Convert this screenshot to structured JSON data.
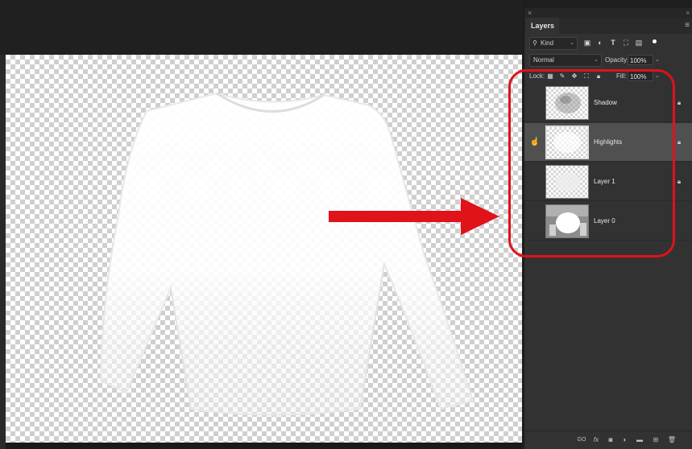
{
  "panel": {
    "tab_label": "Layers",
    "close_glyph": "×",
    "collapse_glyph": "»",
    "menu_glyph": "≡"
  },
  "filter": {
    "kind_label": "Kind",
    "icons": [
      "pixel-filter-icon",
      "adjustment-filter-icon",
      "type-filter-icon",
      "shape-filter-icon",
      "smart-object-filter-icon"
    ]
  },
  "blend": {
    "mode": "Normal",
    "opacity_label": "Opacity:",
    "opacity_value": "100%"
  },
  "lock": {
    "label": "Lock:",
    "fill_label": "Fill:",
    "fill_value": "100%"
  },
  "layers": [
    {
      "name": "Shadow",
      "visible": false,
      "selected": false,
      "locked": true
    },
    {
      "name": "Highlights",
      "visible": true,
      "selected": true,
      "locked": true
    },
    {
      "name": "Layer 1",
      "visible": false,
      "selected": false,
      "locked": true
    },
    {
      "name": "Layer 0",
      "visible": false,
      "selected": false,
      "locked": false
    }
  ],
  "footer": {
    "labels": [
      "GO",
      "fx"
    ]
  },
  "colors": {
    "annotation_red": "#e0121a",
    "panel_bg": "#323232",
    "selected_row": "#505050"
  }
}
